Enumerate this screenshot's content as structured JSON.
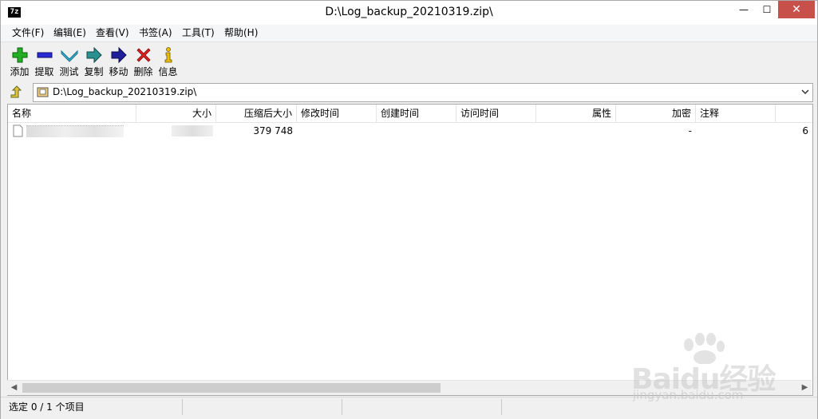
{
  "window": {
    "app_icon_text": "7z",
    "title": "D:\\Log_backup_20210319.zip\\",
    "minimize": "—",
    "maximize": "☐",
    "close": "✕"
  },
  "menu": {
    "items": [
      {
        "label": "文件(F)"
      },
      {
        "label": "编辑(E)"
      },
      {
        "label": "查看(V)"
      },
      {
        "label": "书签(A)"
      },
      {
        "label": "工具(T)"
      },
      {
        "label": "帮助(H)"
      }
    ]
  },
  "toolbar": {
    "buttons": [
      {
        "label": "添加",
        "icon": "plus-icon",
        "color": "#1fa51f"
      },
      {
        "label": "提取",
        "icon": "minus-icon",
        "color": "#2424c8"
      },
      {
        "label": "测试",
        "icon": "checkmark-icon",
        "color": "#2aa6c9"
      },
      {
        "label": "复制",
        "icon": "copy-arrow-icon",
        "color": "#1f7f7f"
      },
      {
        "label": "移动",
        "icon": "move-arrow-icon",
        "color": "#1a1a8c"
      },
      {
        "label": "删除",
        "icon": "delete-x-icon",
        "color": "#d21a1a"
      },
      {
        "label": "信息",
        "icon": "info-icon",
        "color": "#d6b000"
      }
    ]
  },
  "address": {
    "path": "D:\\Log_backup_20210319.zip\\"
  },
  "columns": [
    {
      "label": "名称"
    },
    {
      "label": "大小"
    },
    {
      "label": "压缩后大小"
    },
    {
      "label": "修改时间"
    },
    {
      "label": "创建时间"
    },
    {
      "label": "访问时间"
    },
    {
      "label": "属性"
    },
    {
      "label": "加密"
    },
    {
      "label": "注释"
    }
  ],
  "rows": [
    {
      "name": "",
      "size": "",
      "packed_size": "379 748",
      "modified": "",
      "created": "",
      "accessed": "",
      "attributes": "",
      "encrypted": "-",
      "comment": "",
      "overflow": "6"
    }
  ],
  "status": {
    "selection": "选定 0 / 1 个项目"
  },
  "watermark": {
    "logo": "Baidu经验",
    "url": "jingyan.baidu.com"
  }
}
